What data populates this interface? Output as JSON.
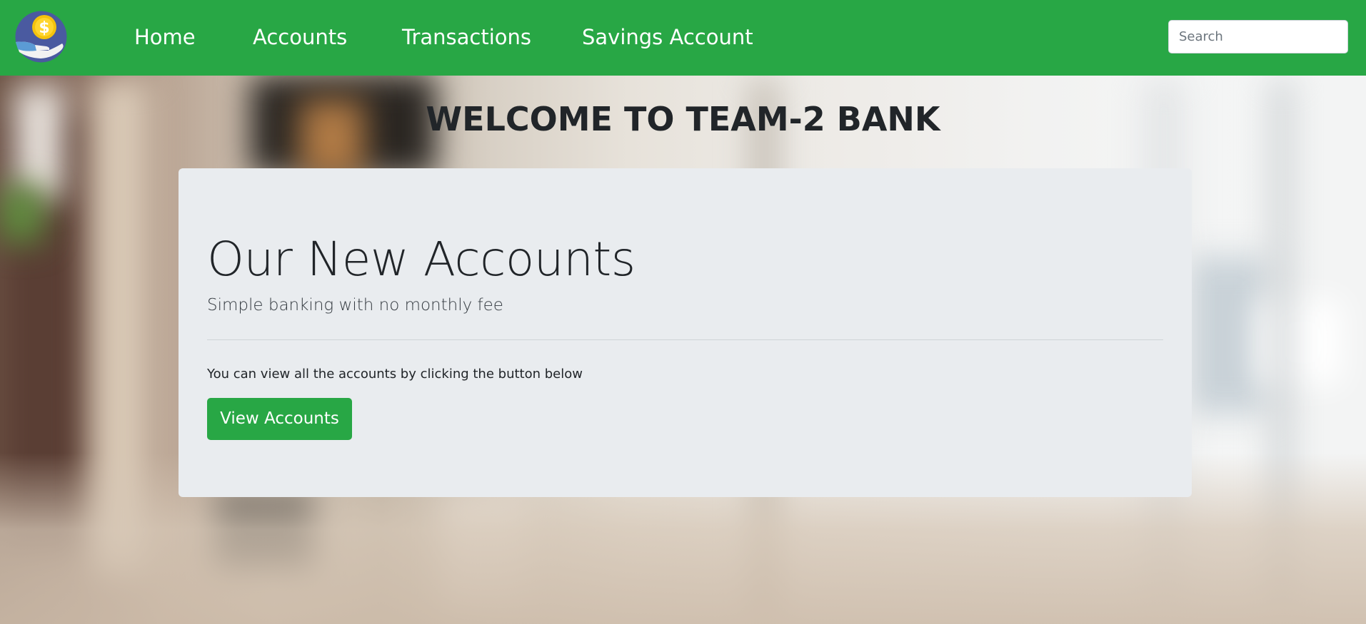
{
  "colors": {
    "navbar_bg": "#28a745",
    "button_bg": "#28a745",
    "jumbotron_bg": "#e9ecef",
    "heading_text": "#212529",
    "logo_circle": "#4a5aa0",
    "logo_coin": "#f4c20d"
  },
  "navbar": {
    "logo_icon": "hand-holding-coin-icon",
    "logo_coin_symbol": "$",
    "links": [
      {
        "label": "Home"
      },
      {
        "label": "Accounts"
      },
      {
        "label": "Transactions"
      },
      {
        "label": "Savings Account"
      }
    ],
    "search": {
      "placeholder": "Search",
      "value": ""
    }
  },
  "main": {
    "welcome": "WELCOME TO TEAM-2 BANK",
    "jumbotron": {
      "title": "Our New Accounts",
      "lead": "Simple banking with no monthly fee",
      "body": "You can view all the accounts by clicking the button below",
      "button_label": "View Accounts"
    }
  }
}
